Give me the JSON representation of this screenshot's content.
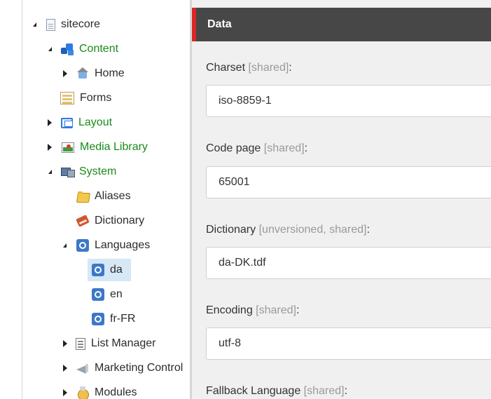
{
  "tree": {
    "items": [
      {
        "label": "sitecore",
        "icon": "document-icon"
      },
      {
        "label": "Content",
        "icon": "content-icon"
      },
      {
        "label": "Home",
        "icon": "home-icon"
      },
      {
        "label": "Forms",
        "icon": "forms-icon"
      },
      {
        "label": "Layout",
        "icon": "layout-icon"
      },
      {
        "label": "Media Library",
        "icon": "media-library-icon"
      },
      {
        "label": "System",
        "icon": "system-icon"
      },
      {
        "label": "Aliases",
        "icon": "folder-icon"
      },
      {
        "label": "Dictionary",
        "icon": "dictionary-icon"
      },
      {
        "label": "Languages",
        "icon": "globe-icon"
      },
      {
        "label": "da",
        "icon": "globe-icon"
      },
      {
        "label": "en",
        "icon": "globe-icon"
      },
      {
        "label": "fr-FR",
        "icon": "globe-icon"
      },
      {
        "label": "List Manager",
        "icon": "list-icon"
      },
      {
        "label": "Marketing Control",
        "icon": "megaphone-icon"
      },
      {
        "label": "Modules",
        "icon": "modules-icon"
      }
    ],
    "selected": "da",
    "green_color": "#1a8a1a",
    "selected_bg": "#d6e8f5"
  },
  "section": {
    "title": "Data",
    "accent_color": "#dc2626",
    "header_bg": "#474747"
  },
  "fields": [
    {
      "label": "Charset",
      "meta": "[shared]",
      "suffix": ":",
      "value": "iso-8859-1"
    },
    {
      "label": "Code page",
      "meta": "[shared]",
      "suffix": ":",
      "value": "65001"
    },
    {
      "label": "Dictionary",
      "meta": "[unversioned, shared]",
      "suffix": ":",
      "value": "da-DK.tdf"
    },
    {
      "label": "Encoding",
      "meta": "[shared]",
      "suffix": ":",
      "value": "utf-8"
    },
    {
      "label": "Fallback Language",
      "meta": "[shared]",
      "suffix": ":"
    }
  ]
}
